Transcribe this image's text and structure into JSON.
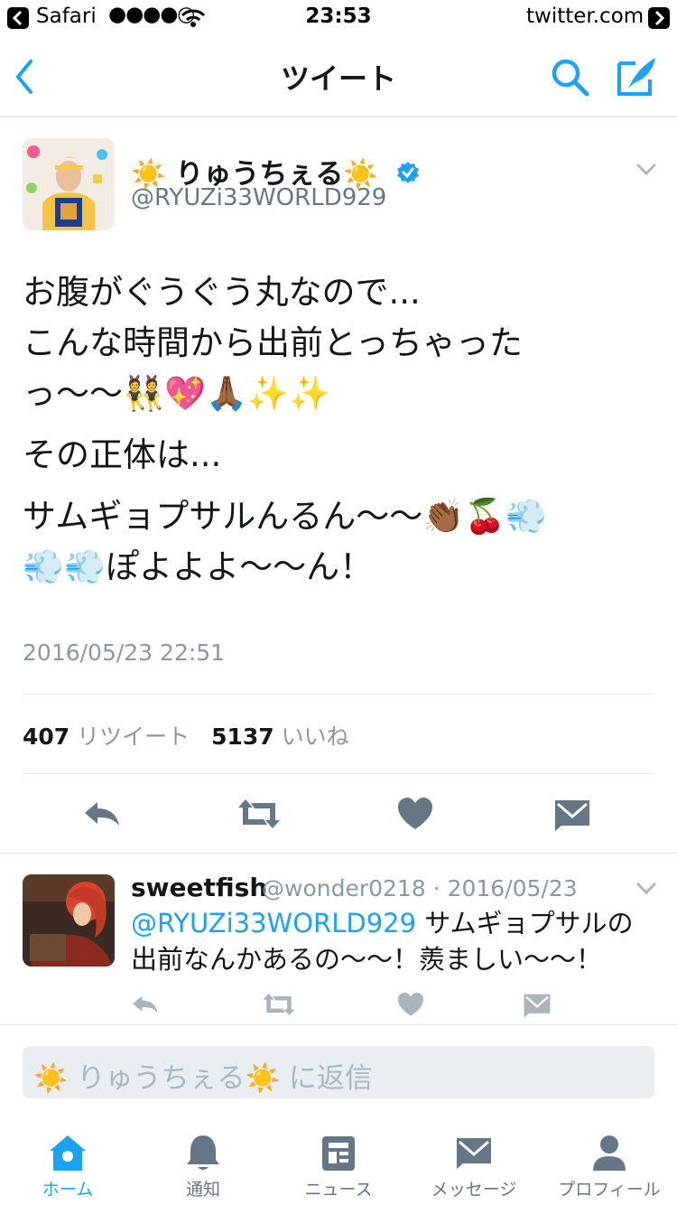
{
  "status_bar": {
    "back_app": "Safari",
    "signal": "●●●●○",
    "time": "23:53",
    "site": "twitter.com"
  },
  "nav": {
    "title": "ツイート"
  },
  "tweet": {
    "display_name": "☀️ りゅうちぇる☀️",
    "handle": "@RYUZi33WORLD929",
    "lines": [
      "お腹がぐうぐう丸なので...",
      "こんな時間から出前とっちゃった",
      "っ〜〜👯💖🙏🏾✨✨"
    ],
    "line2": "その正体は...",
    "lines3": [
      "サムギョプサルんるん〜〜👏🏾🍒💨",
      "💨💨ぽよよよ〜〜ん！"
    ],
    "timestamp": "2016/05/23 22:51",
    "retweet_count": "407",
    "retweet_label": "リツイート",
    "like_count": "5137",
    "like_label": "いいね"
  },
  "reply": {
    "name": "sweetfish",
    "meta": "@wonder0218 · 2016/05/23",
    "mention": "@RYUZi33WORLD929",
    "text": " サムギョプサルの出前なんかあるの〜〜！羨ましい〜〜！"
  },
  "compose": {
    "placeholder": "☀️ りゅうちぇる☀️ に返信"
  },
  "tabs": [
    {
      "label": "ホーム"
    },
    {
      "label": "通知"
    },
    {
      "label": "ニュース"
    },
    {
      "label": "メッセージ"
    },
    {
      "label": "プロフィール"
    }
  ],
  "colors": {
    "accent": "#1da1f2",
    "icon_gray": "#657786",
    "verified": "#1da1f2"
  }
}
